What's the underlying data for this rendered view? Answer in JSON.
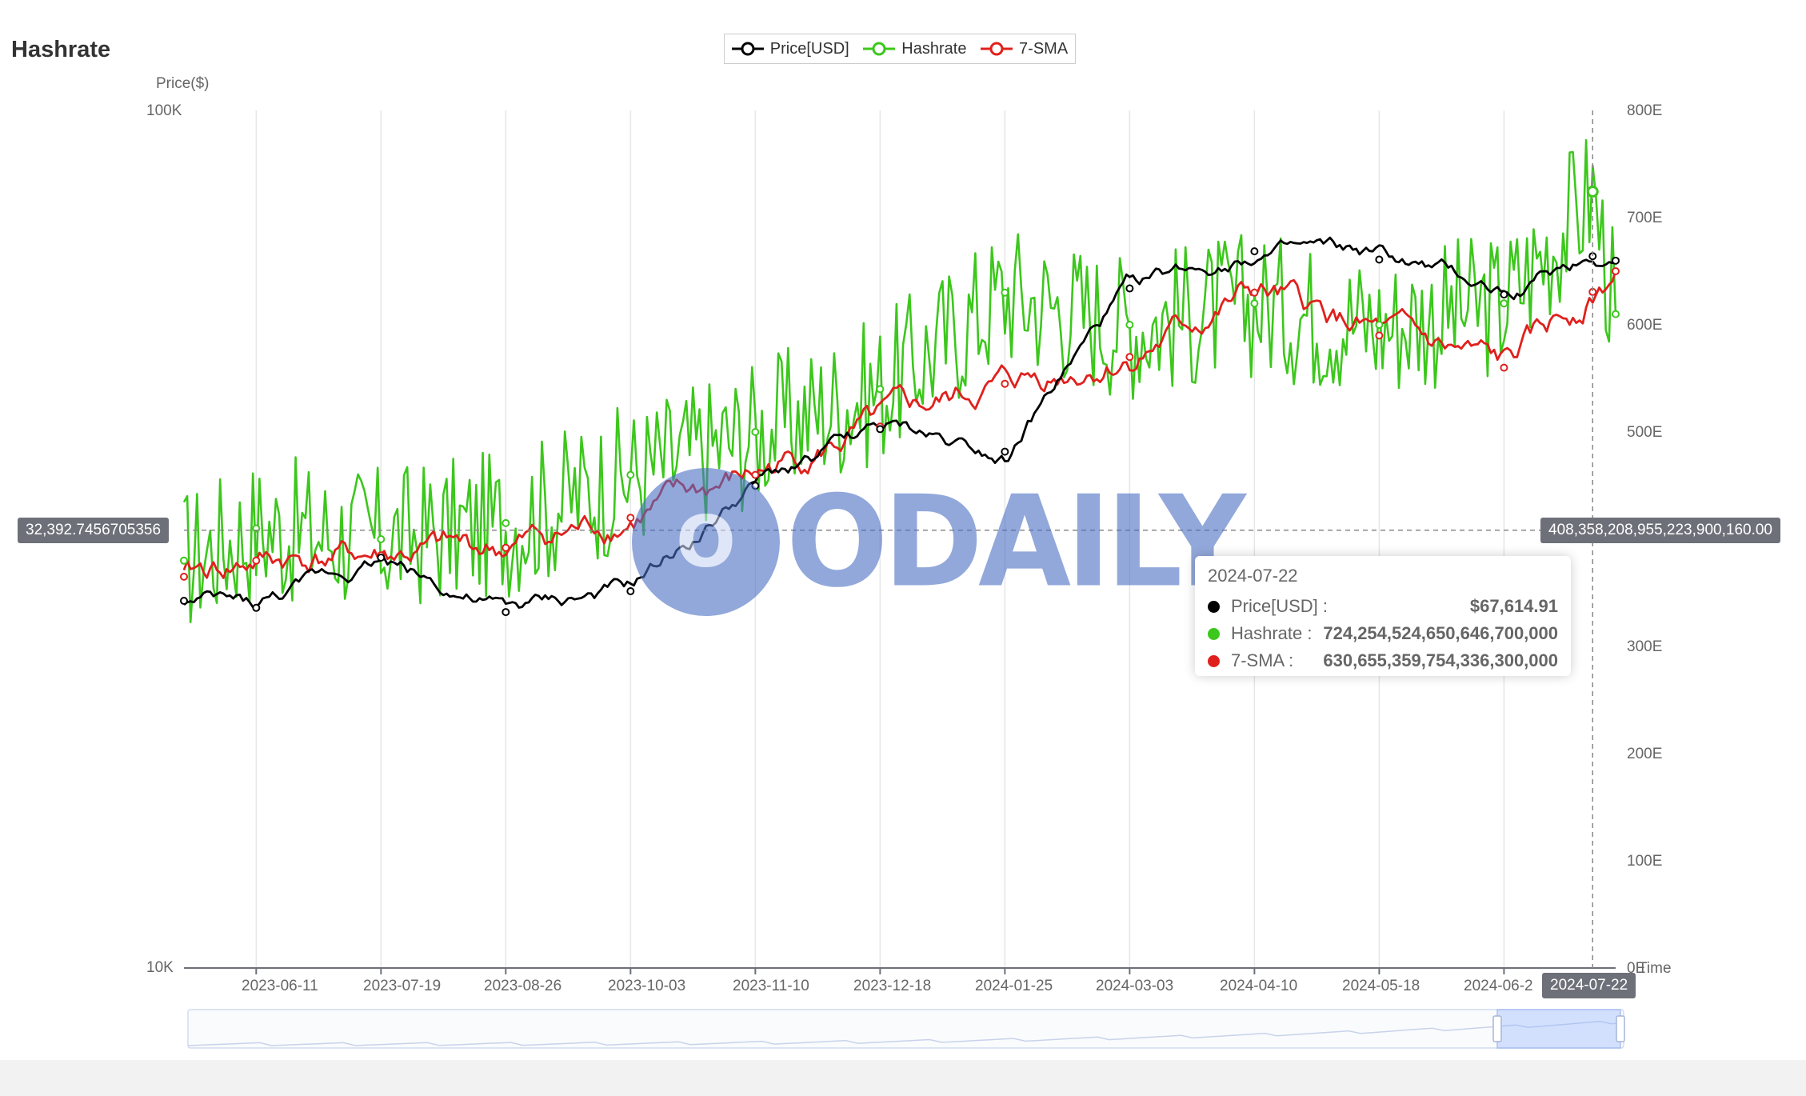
{
  "title": "Hashrate",
  "legend": [
    {
      "name": "Price[USD]",
      "color": "#000000"
    },
    {
      "name": "Hashrate",
      "color": "#3cc71c"
    },
    {
      "name": "7-SMA",
      "color": "#e0201c"
    }
  ],
  "axis": {
    "left_name": "Price($)",
    "x_name": "Time",
    "left_ticks": [
      "100K",
      "10K"
    ],
    "right_ticks": [
      "800E",
      "700E",
      "600E",
      "500E",
      "300E",
      "200E",
      "100E",
      "0E"
    ],
    "x_ticks": [
      "2023-06-11",
      "2023-07-19",
      "2023-08-26",
      "2023-10-03",
      "2023-11-10",
      "2023-12-18",
      "2024-01-25",
      "2024-03-03",
      "2024-04-10",
      "2024-05-18",
      "2024-06-2"
    ]
  },
  "pointer": {
    "left_value": "32,392.7456705356",
    "right_value": "408,358,208,955,223,900,160.00",
    "x_value": "2024-07-22"
  },
  "tooltip": {
    "date": "2024-07-22",
    "rows": [
      {
        "name": "Price[USD] :",
        "value": "$67,614.91",
        "color": "#000000"
      },
      {
        "name": "Hashrate :",
        "value": "724,254,524,650,646,700,000",
        "color": "#3cc71c"
      },
      {
        "name": "7-SMA :",
        "value": "630,655,359,754,336,300,000",
        "color": "#e0201c"
      }
    ]
  },
  "watermark": {
    "mark": "O",
    "text": "ODAILY"
  },
  "chart_data": {
    "type": "line",
    "title": "Hashrate",
    "xlabel": "Time",
    "ylabel_left": "Price($)",
    "y_left_scale": "log",
    "ylim_left": [
      10000,
      100000
    ],
    "ylim_right_EH": [
      0,
      800
    ],
    "grid": "vertical",
    "legend_position": "top-center",
    "x": [
      "2023-05-20",
      "2023-06-11",
      "2023-07-19",
      "2023-08-26",
      "2023-10-03",
      "2023-11-10",
      "2023-12-18",
      "2024-01-25",
      "2024-03-03",
      "2024-04-10",
      "2024-05-18",
      "2024-06-25",
      "2024-07-22",
      "2024-07-29"
    ],
    "series": [
      {
        "name": "Price[USD]",
        "axis": "left",
        "values": [
          26800,
          26300,
          30100,
          26000,
          27500,
          36500,
          42500,
          40000,
          62000,
          68500,
          67000,
          61000,
          67614.91,
          66800
        ]
      },
      {
        "name": "Hashrate",
        "axis": "right",
        "unit": "EH/s",
        "values": [
          380,
          410,
          400,
          415,
          460,
          500,
          540,
          630,
          600,
          620,
          600,
          620,
          724.25,
          610
        ]
      },
      {
        "name": "7-SMA",
        "axis": "right",
        "unit": "EH/s",
        "values": [
          365,
          380,
          385,
          392,
          420,
          460,
          505,
          545,
          570,
          630,
          590,
          560,
          630.66,
          650
        ]
      }
    ]
  }
}
